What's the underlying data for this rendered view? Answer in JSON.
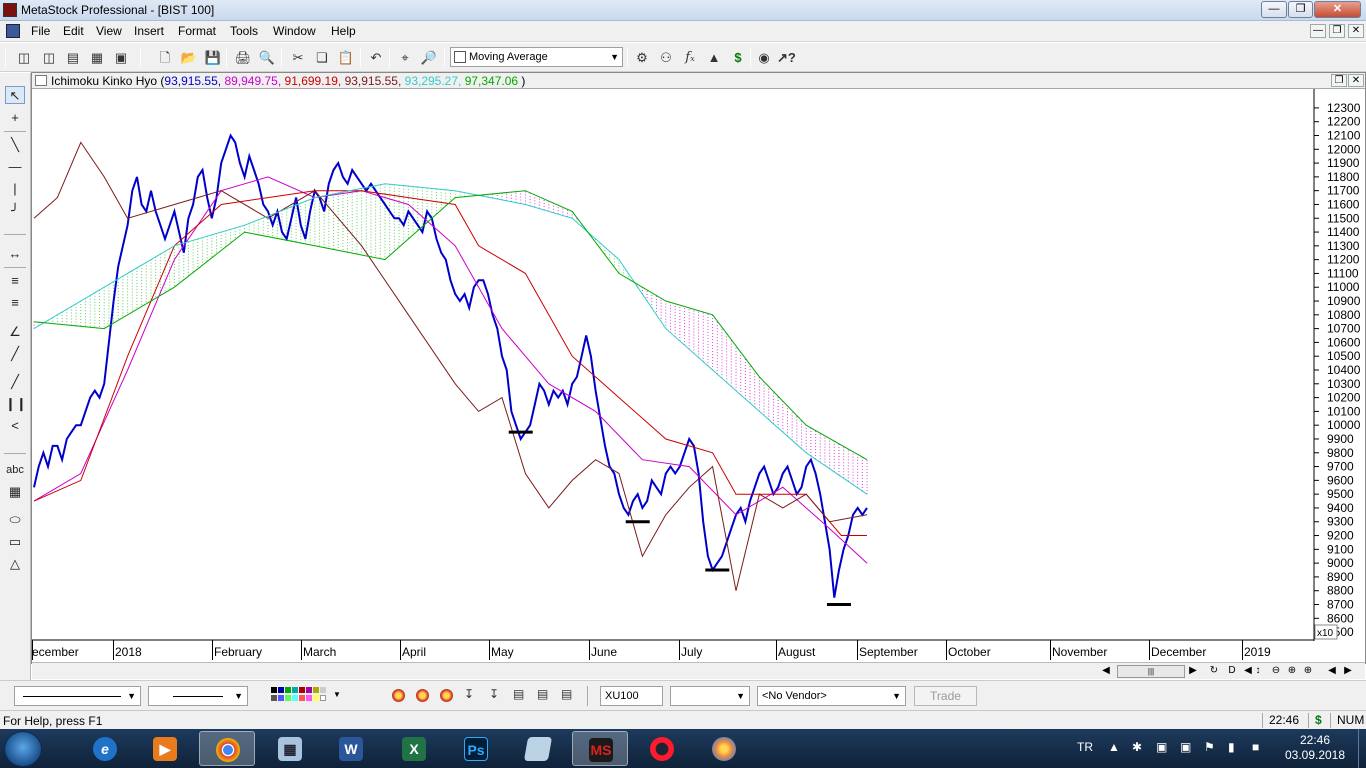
{
  "window": {
    "title": "MetaStock Professional - [BIST 100]"
  },
  "menu": [
    "File",
    "Edit",
    "View",
    "Insert",
    "Format",
    "Tools",
    "Window",
    "Help"
  ],
  "toolbar": {
    "indicator_select": "Moving Average"
  },
  "chart": {
    "legend_name": "Ichimoku Kinko Hyo",
    "legend_values": [
      {
        "text": "93,915.55,",
        "color": "#0000cc"
      },
      {
        "text": "89,949.75,",
        "color": "#cc00cc"
      },
      {
        "text": "91,699.19,",
        "color": "#cc0000"
      },
      {
        "text": "93,915.55,",
        "color": "#7a1a1a"
      },
      {
        "text": "93,295.27,",
        "color": "#33cccc"
      },
      {
        "text": "97,347.06",
        "color": "#00aa00"
      }
    ],
    "legend_close": ")",
    "scale_label": "x10",
    "x_axis_months": [
      "ecember",
      "2018",
      "February",
      "March",
      "April",
      "May",
      "June",
      "July",
      "August",
      "September",
      "October",
      "November",
      "December",
      "2019"
    ]
  },
  "chart_data": {
    "type": "line",
    "title": "",
    "y_unit_note": "x10",
    "ylim": [
      8450,
      12350
    ],
    "y_ticks": [
      8500,
      8600,
      8700,
      8800,
      8900,
      9000,
      9100,
      9200,
      9300,
      9400,
      9500,
      9600,
      9700,
      9800,
      9900,
      10000,
      10100,
      10200,
      10300,
      10400,
      10500,
      10600,
      10700,
      10800,
      10900,
      11000,
      11100,
      11200,
      11300,
      11400,
      11500,
      11600,
      11700,
      11800,
      11900,
      12000,
      12100,
      12200,
      12300
    ],
    "x_unit": "trading-day index (0 = late December 2017)",
    "series": [
      {
        "color": "#0000cc",
        "values": [
          [
            0,
            9550
          ],
          [
            2,
            9700
          ],
          [
            4,
            9800
          ],
          [
            6,
            9700
          ],
          [
            8,
            9850
          ],
          [
            10,
            9850
          ],
          [
            12,
            9750
          ],
          [
            14,
            9900
          ],
          [
            16,
            9950
          ],
          [
            18,
            10000
          ],
          [
            20,
            10000
          ],
          [
            22,
            10100
          ],
          [
            24,
            10200
          ],
          [
            26,
            10250
          ],
          [
            28,
            10200
          ],
          [
            30,
            10300
          ],
          [
            32,
            10600
          ],
          [
            34,
            10900
          ],
          [
            36,
            11150
          ],
          [
            38,
            11300
          ],
          [
            40,
            11450
          ],
          [
            42,
            11700
          ],
          [
            44,
            11800
          ],
          [
            46,
            11600
          ],
          [
            48,
            11550
          ],
          [
            50,
            11700
          ],
          [
            52,
            11550
          ],
          [
            54,
            11450
          ],
          [
            56,
            11350
          ],
          [
            58,
            11450
          ],
          [
            60,
            11550
          ],
          [
            62,
            11400
          ],
          [
            64,
            11250
          ],
          [
            66,
            11500
          ],
          [
            68,
            11600
          ],
          [
            70,
            11800
          ],
          [
            72,
            11850
          ],
          [
            74,
            11650
          ],
          [
            76,
            11500
          ],
          [
            78,
            11650
          ],
          [
            80,
            11900
          ],
          [
            82,
            12000
          ],
          [
            84,
            12100
          ],
          [
            86,
            12050
          ],
          [
            88,
            11900
          ],
          [
            90,
            11800
          ],
          [
            92,
            11950
          ],
          [
            94,
            11850
          ],
          [
            96,
            11750
          ],
          [
            98,
            11600
          ],
          [
            100,
            11550
          ],
          [
            102,
            11450
          ],
          [
            104,
            11550
          ],
          [
            106,
            11400
          ],
          [
            108,
            11350
          ],
          [
            110,
            11500
          ],
          [
            112,
            11650
          ],
          [
            114,
            11450
          ],
          [
            116,
            11350
          ],
          [
            118,
            11550
          ],
          [
            120,
            11700
          ],
          [
            122,
            11650
          ],
          [
            124,
            11550
          ],
          [
            126,
            11750
          ],
          [
            128,
            11850
          ],
          [
            130,
            11900
          ],
          [
            132,
            11800
          ],
          [
            134,
            11750
          ],
          [
            136,
            11850
          ],
          [
            138,
            11800
          ],
          [
            140,
            11750
          ],
          [
            142,
            11700
          ],
          [
            144,
            11750
          ],
          [
            146,
            11700
          ],
          [
            148,
            11650
          ],
          [
            150,
            11600
          ],
          [
            152,
            11550
          ],
          [
            154,
            11500
          ],
          [
            156,
            11500
          ],
          [
            158,
            11450
          ],
          [
            160,
            11550
          ],
          [
            162,
            11500
          ],
          [
            164,
            11450
          ],
          [
            166,
            11400
          ],
          [
            168,
            11550
          ],
          [
            170,
            11500
          ],
          [
            172,
            11350
          ],
          [
            174,
            11250
          ],
          [
            176,
            11200
          ],
          [
            178,
            11050
          ],
          [
            180,
            10950
          ],
          [
            182,
            10900
          ],
          [
            184,
            10950
          ],
          [
            186,
            10850
          ],
          [
            188,
            11000
          ],
          [
            190,
            11050
          ],
          [
            192,
            11050
          ],
          [
            194,
            10950
          ],
          [
            196,
            10800
          ],
          [
            198,
            10700
          ],
          [
            200,
            10500
          ],
          [
            202,
            10400
          ],
          [
            204,
            10100
          ],
          [
            206,
            10000
          ],
          [
            208,
            9900
          ],
          [
            210,
            9950
          ],
          [
            212,
            10000
          ],
          [
            214,
            10150
          ],
          [
            216,
            10300
          ],
          [
            218,
            10250
          ],
          [
            220,
            10150
          ],
          [
            222,
            10250
          ],
          [
            224,
            10200
          ],
          [
            226,
            10250
          ],
          [
            228,
            10150
          ],
          [
            230,
            10300
          ],
          [
            232,
            10350
          ],
          [
            234,
            10500
          ],
          [
            236,
            10650
          ],
          [
            238,
            10500
          ],
          [
            240,
            10250
          ],
          [
            242,
            10050
          ],
          [
            244,
            9850
          ],
          [
            246,
            9700
          ],
          [
            248,
            9650
          ],
          [
            250,
            9500
          ],
          [
            252,
            9400
          ],
          [
            254,
            9350
          ],
          [
            256,
            9450
          ],
          [
            258,
            9500
          ],
          [
            260,
            9400
          ],
          [
            262,
            9450
          ],
          [
            264,
            9600
          ],
          [
            266,
            9550
          ],
          [
            268,
            9500
          ],
          [
            270,
            9650
          ],
          [
            272,
            9700
          ],
          [
            274,
            9650
          ],
          [
            276,
            9700
          ],
          [
            278,
            9800
          ],
          [
            280,
            9900
          ],
          [
            282,
            9850
          ],
          [
            284,
            9650
          ],
          [
            286,
            9300
          ],
          [
            288,
            9050
          ],
          [
            290,
            8950
          ],
          [
            292,
            9000
          ],
          [
            294,
            9050
          ],
          [
            296,
            9150
          ],
          [
            298,
            9250
          ],
          [
            300,
            9350
          ],
          [
            302,
            9400
          ],
          [
            304,
            9300
          ],
          [
            306,
            9450
          ],
          [
            308,
            9550
          ],
          [
            310,
            9650
          ],
          [
            312,
            9700
          ],
          [
            314,
            9600
          ],
          [
            316,
            9500
          ],
          [
            318,
            9550
          ],
          [
            320,
            9650
          ],
          [
            322,
            9700
          ],
          [
            324,
            9600
          ],
          [
            326,
            9500
          ],
          [
            328,
            9550
          ],
          [
            330,
            9700
          ],
          [
            332,
            9750
          ],
          [
            334,
            9650
          ],
          [
            336,
            9500
          ],
          [
            338,
            9300
          ],
          [
            340,
            9100
          ],
          [
            342,
            8750
          ],
          [
            344,
            8950
          ],
          [
            346,
            9100
          ],
          [
            348,
            9200
          ],
          [
            350,
            9350
          ],
          [
            352,
            9400
          ],
          [
            354,
            9350
          ],
          [
            356,
            9400
          ]
        ]
      },
      {
        "color": "#cc00cc",
        "values": [
          [
            0,
            9450
          ],
          [
            20,
            9650
          ],
          [
            40,
            10400
          ],
          [
            60,
            11200
          ],
          [
            80,
            11700
          ],
          [
            100,
            11800
          ],
          [
            120,
            11650
          ],
          [
            140,
            11700
          ],
          [
            160,
            11600
          ],
          [
            180,
            11300
          ],
          [
            200,
            10700
          ],
          [
            220,
            10300
          ],
          [
            240,
            10100
          ],
          [
            260,
            9750
          ],
          [
            280,
            9700
          ],
          [
            300,
            9350
          ],
          [
            320,
            9550
          ],
          [
            340,
            9250
          ],
          [
            356,
            9000
          ]
        ]
      },
      {
        "color": "#cc0000",
        "values": [
          [
            0,
            9450
          ],
          [
            20,
            9600
          ],
          [
            40,
            10500
          ],
          [
            60,
            11300
          ],
          [
            80,
            11600
          ],
          [
            100,
            11650
          ],
          [
            120,
            11700
          ],
          [
            140,
            11700
          ],
          [
            160,
            11650
          ],
          [
            180,
            11600
          ],
          [
            190,
            11300
          ],
          [
            210,
            11100
          ],
          [
            230,
            10500
          ],
          [
            250,
            10200
          ],
          [
            270,
            9900
          ],
          [
            290,
            9800
          ],
          [
            300,
            9500
          ],
          [
            330,
            9500
          ],
          [
            345,
            9200
          ],
          [
            356,
            9200
          ]
        ]
      },
      {
        "color": "#7a1a1a",
        "values": [
          [
            0,
            11500
          ],
          [
            10,
            11650
          ],
          [
            20,
            12050
          ],
          [
            30,
            11800
          ],
          [
            40,
            11500
          ],
          [
            60,
            11600
          ],
          [
            80,
            11700
          ],
          [
            100,
            11500
          ],
          [
            120,
            11700
          ],
          [
            140,
            11300
          ],
          [
            160,
            10800
          ],
          [
            180,
            10300
          ],
          [
            190,
            10100
          ],
          [
            200,
            10200
          ],
          [
            210,
            9650
          ],
          [
            220,
            9400
          ],
          [
            230,
            9600
          ],
          [
            240,
            9750
          ],
          [
            250,
            9650
          ],
          [
            260,
            9050
          ],
          [
            270,
            9350
          ],
          [
            280,
            9550
          ],
          [
            290,
            9700
          ],
          [
            300,
            8800
          ],
          [
            310,
            9500
          ],
          [
            320,
            9400
          ],
          [
            330,
            9500
          ],
          [
            340,
            9300
          ],
          [
            356,
            9350
          ]
        ]
      },
      {
        "color": "#33cccc",
        "values": [
          [
            0,
            10700
          ],
          [
            30,
            11000
          ],
          [
            60,
            11300
          ],
          [
            90,
            11450
          ],
          [
            120,
            11650
          ],
          [
            150,
            11750
          ],
          [
            180,
            11700
          ],
          [
            210,
            11600
          ],
          [
            230,
            11500
          ],
          [
            250,
            11200
          ],
          [
            270,
            10700
          ],
          [
            290,
            10400
          ],
          [
            310,
            10100
          ],
          [
            330,
            9800
          ],
          [
            356,
            9500
          ]
        ]
      },
      {
        "color": "#00aa00",
        "values": [
          [
            0,
            10750
          ],
          [
            30,
            10700
          ],
          [
            60,
            11000
          ],
          [
            90,
            11400
          ],
          [
            120,
            11300
          ],
          [
            150,
            11200
          ],
          [
            180,
            11650
          ],
          [
            210,
            11700
          ],
          [
            230,
            11550
          ],
          [
            250,
            11100
          ],
          [
            270,
            10900
          ],
          [
            290,
            10800
          ],
          [
            310,
            10350
          ],
          [
            330,
            10000
          ],
          [
            356,
            9750
          ]
        ]
      }
    ],
    "support_marks": [
      9950,
      9300,
      8950,
      8700
    ]
  },
  "bottom_bar": {
    "symbol": "XU100",
    "vendor": "<No Vendor>",
    "trade_label": "Trade"
  },
  "status": {
    "help": "For Help, press F1",
    "time": "22:46",
    "dollar": "$",
    "num": "NUM"
  },
  "taskbar": {
    "lang": "TR",
    "clock_time": "22:46",
    "clock_date": "03.09.2018"
  }
}
